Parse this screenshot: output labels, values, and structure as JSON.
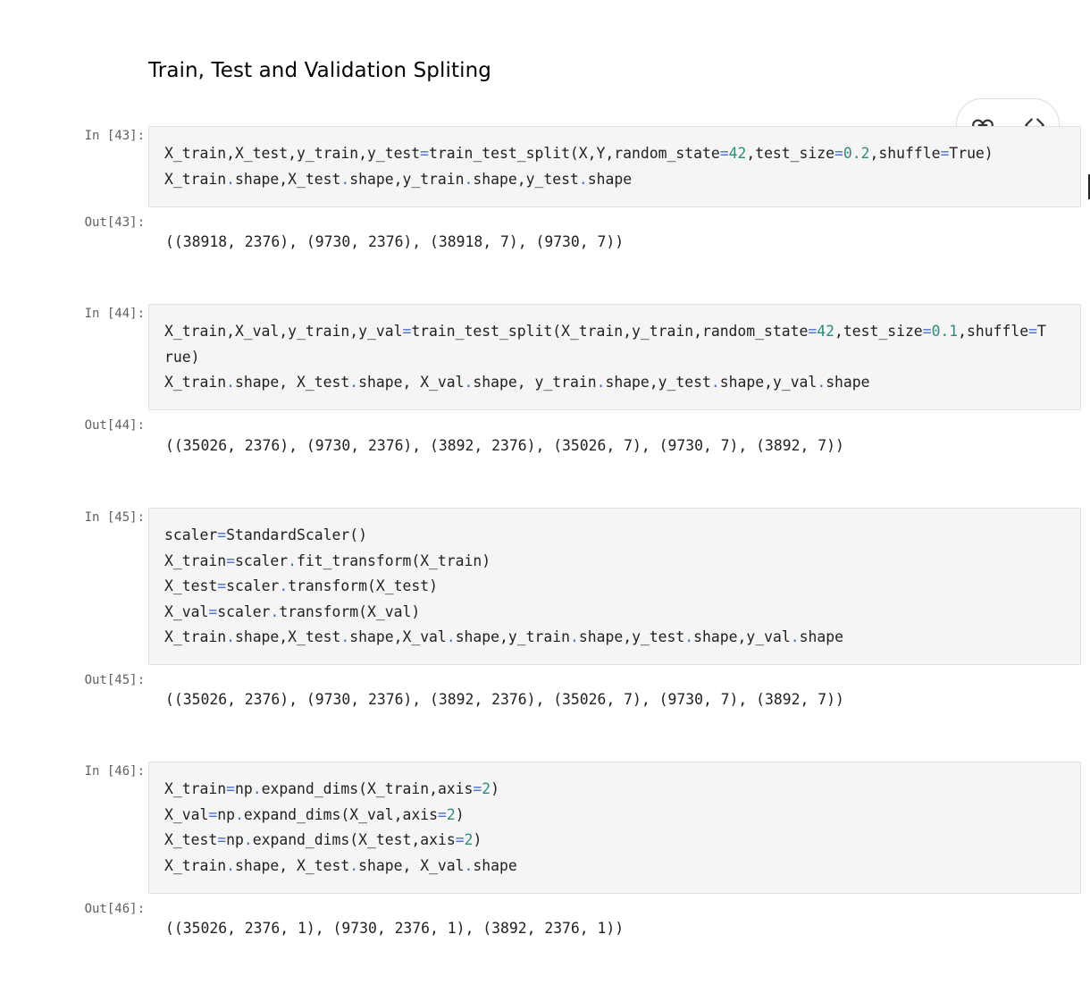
{
  "notebook": {
    "heading": "Train, Test and Validation Spliting",
    "toolbar": {
      "link_icon": "link-icon",
      "code_icon": "code-brackets-icon"
    },
    "cells": [
      {
        "in_prompt": "In [43]:",
        "code_lines": [
          "X_train,X_test,y_train,y_test=train_test_split(X,Y,random_state=42,test_size=0.2,shuffle=True)",
          "X_train.shape,X_test.shape,y_train.shape,y_test.shape"
        ],
        "out_prompt": "Out[43]:",
        "output": "((38918, 2376), (9730, 2376), (38918, 7), (9730, 7))"
      },
      {
        "in_prompt": "In [44]:",
        "code_lines": [
          "X_train,X_val,y_train,y_val=train_test_split(X_train,y_train,random_state=42,test_size=0.1,shuffle=T",
          "rue)",
          "X_train.shape, X_test.shape, X_val.shape, y_train.shape,y_test.shape,y_val.shape"
        ],
        "out_prompt": "Out[44]:",
        "output": "((35026, 2376), (9730, 2376), (3892, 2376), (35026, 7), (9730, 7), (3892, 7))"
      },
      {
        "in_prompt": "In [45]:",
        "code_lines": [
          "scaler=StandardScaler()",
          "X_train=scaler.fit_transform(X_train)",
          "X_test=scaler.transform(X_test)",
          "X_val=scaler.transform(X_val)",
          "X_train.shape,X_test.shape,X_val.shape,y_train.shape,y_test.shape,y_val.shape"
        ],
        "out_prompt": "Out[45]:",
        "output": "((35026, 2376), (9730, 2376), (3892, 2376), (35026, 7), (9730, 7), (3892, 7))"
      },
      {
        "in_prompt": "In [46]:",
        "code_lines": [
          "X_train=np.expand_dims(X_train,axis=2)",
          "X_val=np.expand_dims(X_val,axis=2)",
          "X_test=np.expand_dims(X_test,axis=2)",
          "X_train.shape, X_test.shape, X_val.shape"
        ],
        "out_prompt": "Out[46]:",
        "output": "((35026, 2376, 1), (9730, 2376, 1), (3892, 2376, 1))"
      }
    ]
  }
}
